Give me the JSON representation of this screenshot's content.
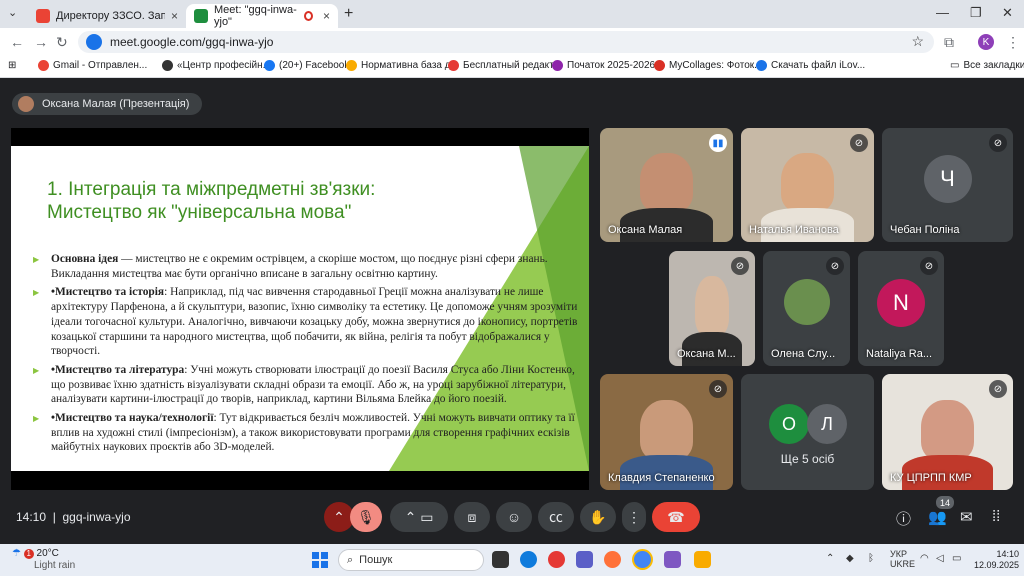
{
  "browser": {
    "tabs": [
      {
        "title": "Директору ЗЗСО. Запрошенн",
        "icon": "gmail-icon",
        "color": "#ea4335"
      },
      {
        "title": "Meet: \"ggq-inwa-yjo\"",
        "icon": "meet-icon",
        "color": "#1e8e3e"
      }
    ],
    "url": "meet.google.com/ggq-inwa-yjo",
    "profile_initial": "K",
    "bookmarks": [
      {
        "label": "Gmail - Отправлен...",
        "color": "#ea4335"
      },
      {
        "label": "«Центр професійн...",
        "color": "#333"
      },
      {
        "label": "(20+) Facebook",
        "color": "#1877f2"
      },
      {
        "label": "Нормативна база д...",
        "color": "#f9ab00"
      },
      {
        "label": "Бесплатный редакт...",
        "color": "#e53935"
      },
      {
        "label": "Початок 2025-2026...",
        "color": "#8e24aa"
      },
      {
        "label": "MyCollages: Фоток...",
        "color": "#d93025"
      },
      {
        "label": "Скачать файл iLov...",
        "color": "#1a73e8"
      }
    ],
    "all_bookmarks": "Все закладки"
  },
  "meet": {
    "presenter": "Оксана Малая (Презентація)",
    "slide": {
      "title": "1. Інтеграція та міжпредметні зв'язки: Мистецтво як \"універсальна мова\"",
      "points": [
        {
          "bold": "Основна ідея",
          "text": " — мистецтво не є окремим острівцем, а скоріше мостом, що поєднує різні сфери знань. Викладання мистецтва має бути органічно вписане в загальну освітню картину."
        },
        {
          "bold": "•Мистецтво та історія",
          "text": ": Наприклад, під час вивчення стародавньої Греції можна аналізувати не лише архітектуру Парфенона, а й скульптури, вазопис, їхню символіку та естетику. Це допоможе учням зрозуміти ідеали тогочасної культури. Аналогічно, вивчаючи козацьку добу, можна звернутися до іконопису, портретів козацької старшини та народного мистецтва, щоб побачити, як війна, релігія та побут відображалися у творчості."
        },
        {
          "bold": "•Мистецтво та література",
          "text": ": Учні можуть створювати ілюстрації до поезії Василя Стуса або Ліни Костенко, що розвиває їхню здатність візуалізувати складні образи та емоції. Або ж, на уроці зарубіжної літератури, аналізувати картини-ілюстрації до творів, наприклад, картини Вільяма Блейка до його поезій."
        },
        {
          "bold": "•Мистецтво та наука/технології",
          "text": ": Тут відкривається безліч можливостей. Учні можуть вивчати оптику та її вплив на художні стилі (імпресіонізм), а також використовувати програми для створення графічних ескізів майбутніх наукових проєктів або 3D-моделей."
        }
      ]
    },
    "participants": [
      {
        "name": "Оксана Малая",
        "speaking": true
      },
      {
        "name": "Наталья Иванова",
        "speaking": false
      },
      {
        "name": "Чебан Поліна",
        "initial": "Ч",
        "color": "#5f6368"
      },
      {
        "name": "Оксана М...",
        "speaking": false
      },
      {
        "name": "Олена Слу...",
        "speaking": false
      },
      {
        "name": "Nataliya Ra...",
        "initial": "N",
        "color": "#c2185b"
      },
      {
        "name": "Клавдия Степаненко",
        "speaking": false
      },
      {
        "name": "Ще 5 осіб",
        "initials": [
          "О",
          "Л"
        ]
      },
      {
        "name": "КУ ЦПРПП КМР",
        "speaking": false
      }
    ],
    "time": "14:10",
    "code": "ggq-inwa-yjo",
    "people_count": "14"
  },
  "taskbar": {
    "temp": "20°C",
    "weather": "Light rain",
    "weather_badge": "1",
    "search": "Пошук",
    "lang1": "УКР",
    "lang2": "UKRE",
    "time": "14:10",
    "date": "12.09.2025"
  }
}
